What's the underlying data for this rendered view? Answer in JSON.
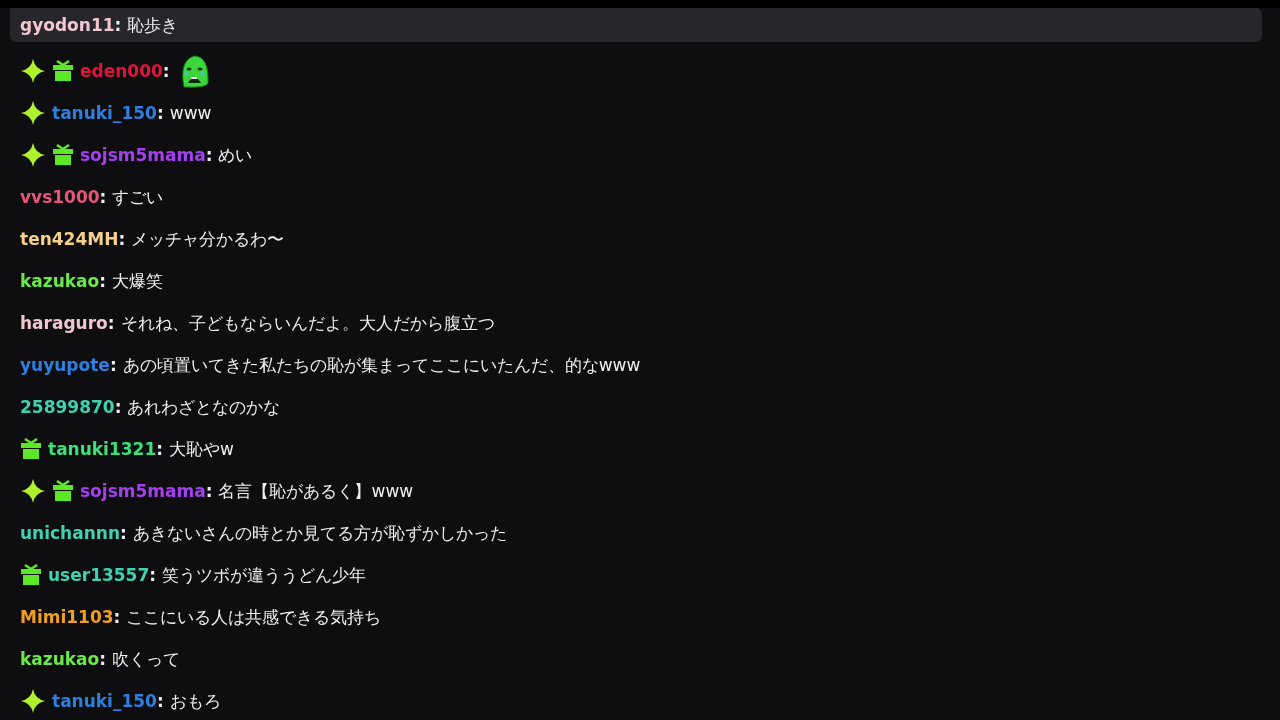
{
  "messages": [
    {
      "highlighted": true,
      "user": "gyodon11",
      "color": "#f4c7d0",
      "separator": ":",
      "body": {
        "kind": "text",
        "text": "恥歩き"
      }
    },
    {
      "highlighted": false,
      "badges": [
        {
          "kind": "star"
        },
        {
          "kind": "gift"
        }
      ],
      "user": "eden000",
      "color": "#e0143c",
      "separator": ":",
      "body": {
        "kind": "emote"
      }
    },
    {
      "highlighted": false,
      "badges": [
        {
          "kind": "star"
        }
      ],
      "user": "tanuki_150",
      "color": "#2e7fe0",
      "separator": ":",
      "body": {
        "kind": "text",
        "text": "www"
      }
    },
    {
      "highlighted": false,
      "badges": [
        {
          "kind": "star"
        },
        {
          "kind": "gift"
        }
      ],
      "user": "sojsm5mama",
      "color": "#a340f0",
      "separator": ":",
      "body": {
        "kind": "text",
        "text": "めい"
      }
    },
    {
      "highlighted": false,
      "user": "vvs1000",
      "color": "#e8557a",
      "separator": ":",
      "body": {
        "kind": "text",
        "text": "すごい"
      }
    },
    {
      "highlighted": false,
      "user": "ten424MH",
      "color": "#f5d08a",
      "separator": ":",
      "body": {
        "kind": "text",
        "text": "メッチャ分かるわ〜"
      }
    },
    {
      "highlighted": false,
      "user": "kazukao",
      "color": "#6be84a",
      "separator": ":",
      "body": {
        "kind": "text",
        "text": "大爆笑"
      }
    },
    {
      "highlighted": false,
      "user": "haraguro",
      "color": "#f2c6cf",
      "separator": ":",
      "body": {
        "kind": "text",
        "text": "それね、子どもならいんだよ。大人だから腹立つ"
      }
    },
    {
      "highlighted": false,
      "user": "yuyupote",
      "color": "#2e7fe0",
      "separator": ":",
      "body": {
        "kind": "text",
        "text": "あの頃置いてきた私たちの恥が集まってここにいたんだ、的なwww"
      }
    },
    {
      "highlighted": false,
      "user": "25899870",
      "color": "#3fd1b0",
      "separator": ":",
      "body": {
        "kind": "text",
        "text": "あれわざとなのかな"
      }
    },
    {
      "highlighted": false,
      "badges": [
        {
          "kind": "gift"
        }
      ],
      "user": "tanuki1321",
      "color": "#3ee07a",
      "separator": ":",
      "body": {
        "kind": "text",
        "text": "大恥やw"
      }
    },
    {
      "highlighted": false,
      "badges": [
        {
          "kind": "star"
        },
        {
          "kind": "gift"
        }
      ],
      "user": "sojsm5mama",
      "color": "#a340f0",
      "separator": ":",
      "body": {
        "kind": "text",
        "text": "名言【恥があるく】www"
      }
    },
    {
      "highlighted": false,
      "user": "unichannn",
      "color": "#3fd1b0",
      "separator": ":",
      "body": {
        "kind": "text",
        "text": "あきないさんの時とか見てる方が恥ずかしかった"
      }
    },
    {
      "highlighted": false,
      "badges": [
        {
          "kind": "gift"
        }
      ],
      "user": "user13557",
      "color": "#3fd1b0",
      "separator": ":",
      "body": {
        "kind": "text",
        "text": "笑うツボが違ううどん少年"
      }
    },
    {
      "highlighted": false,
      "user": "Mimi1103",
      "color": "#f0a020",
      "separator": ":",
      "body": {
        "kind": "text",
        "text": "ここにいる人は共感できる気持ち"
      }
    },
    {
      "highlighted": false,
      "user": "kazukao",
      "color": "#6be84a",
      "separator": ":",
      "body": {
        "kind": "text",
        "text": "吹くって"
      }
    },
    {
      "highlighted": false,
      "badges": [
        {
          "kind": "star"
        }
      ],
      "user": "tanuki_150",
      "color": "#2e7fe0",
      "separator": ":",
      "body": {
        "kind": "text",
        "text": "おもろ"
      }
    }
  ]
}
